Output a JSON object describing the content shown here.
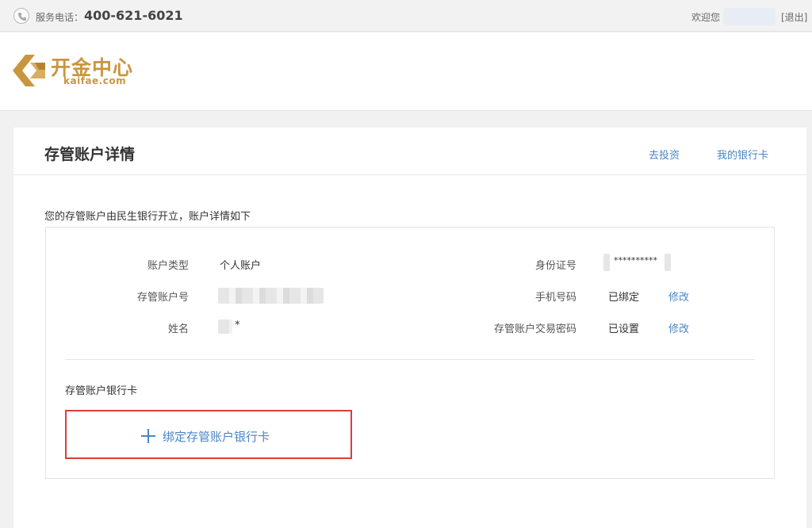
{
  "topbar": {
    "service_label": "服务电话：",
    "service_phone": "400-621-6021",
    "welcome": "欢迎您",
    "logout": "[退出]"
  },
  "logo": {
    "cn": "开金中心",
    "en": "kaifae.com"
  },
  "page": {
    "title": "存管账户详情",
    "links": {
      "invest": "去投资",
      "bankcard": "我的银行卡"
    },
    "intro": "您的存管账户由民生银行开立，账户详情如下"
  },
  "account": {
    "type_label": "账户类型",
    "type_value": "个人账户",
    "number_label": "存管账户号",
    "name_label": "姓名",
    "name_value": "*",
    "id_label": "身份证号",
    "id_value": "**********",
    "phone_label": "手机号码",
    "phone_value": "已绑定",
    "phone_edit": "修改",
    "password_label": "存管账户交易密码",
    "password_value": "已设置",
    "password_edit": "修改"
  },
  "bank_section": {
    "label": "存管账户银行卡",
    "bind_button": "绑定存管账户银行卡"
  },
  "colors": {
    "brand": "#c99640",
    "link": "#4a86c5",
    "highlight": "#e03b3b"
  }
}
